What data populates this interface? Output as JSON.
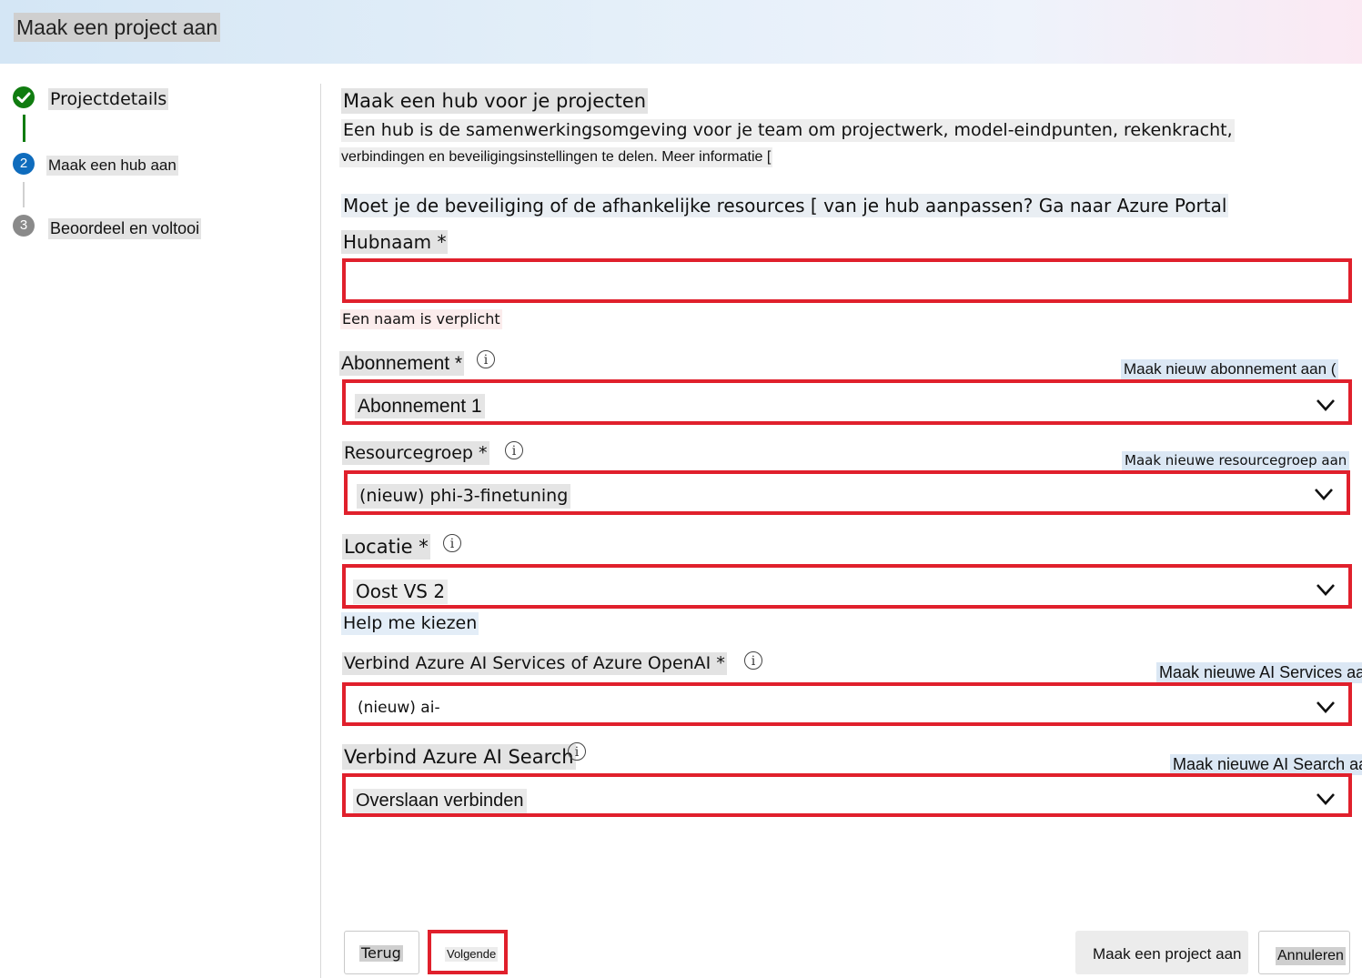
{
  "header": {
    "title": "Maak een project aan"
  },
  "stepper": {
    "steps": [
      {
        "number": "✓",
        "label": "Projectdetails",
        "status": "completed"
      },
      {
        "number": "2",
        "label": "Maak een hub aan",
        "status": "current"
      },
      {
        "number": "3",
        "label": "Beoordeel en voltooi",
        "status": "pending"
      }
    ]
  },
  "main": {
    "heading": "Maak een hub voor je projecten",
    "description_line1": "Een hub is de samenwerkingsomgeving voor je team om projectwerk, model-eindpunten, rekenkracht,",
    "description_line2": "verbindingen en beveiligingsinstellingen te delen. Meer informatie [",
    "azure_portal_note": "Moet je de beveiliging of de afhankelijke resources [ van je hub aanpassen? Ga naar Azure Portal",
    "hub_name": {
      "label": "Hubnaam *",
      "value": "",
      "error": "Een naam is verplicht"
    },
    "subscription": {
      "label": "Abonnement *",
      "value": "Abonnement 1",
      "create_link": "Maak nieuw abonnement aan ("
    },
    "resource_group": {
      "label": "Resourcegroep *",
      "value": "(nieuw) phi-3-finetuning",
      "create_link": "Maak nieuwe resourcegroep aan"
    },
    "location": {
      "label": "Locatie *",
      "value": "Oost VS 2",
      "help_link": "Help me kiezen"
    },
    "ai_services": {
      "label": "Verbind Azure AI Services of Azure OpenAI *",
      "value": "(nieuw) ai-",
      "create_link": "Maak nieuwe AI Services aan"
    },
    "ai_search": {
      "label": "Verbind Azure AI Search",
      "value": "Overslaan verbinden",
      "create_link": "Maak nieuwe AI Search aan"
    }
  },
  "footer": {
    "back_label": "Terug",
    "next_label": "Volgende",
    "create_label": "Maak een project aan",
    "cancel_label": "Annuleren"
  },
  "colors": {
    "accent": "#0f6cbd",
    "success": "#107c10",
    "error": "#e0202c",
    "pending": "#8a8a8a"
  },
  "icons": {
    "info": "info-icon",
    "chevron": "chevron-down-icon",
    "check": "checkmark-icon"
  }
}
